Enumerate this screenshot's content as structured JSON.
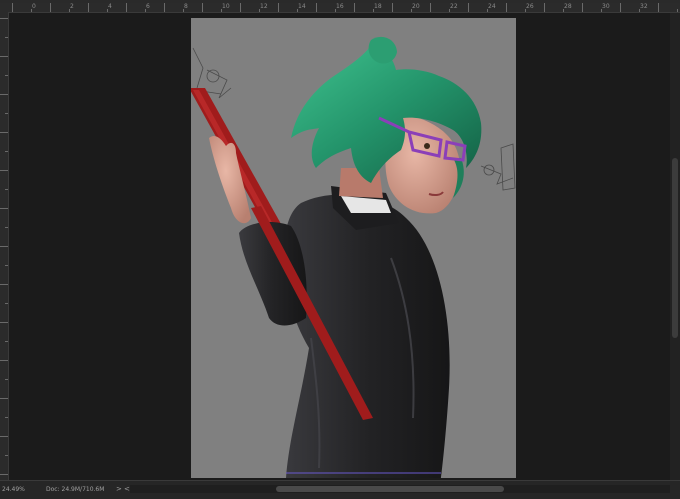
{
  "ruler": {
    "top_labels": [
      "0",
      "2",
      "4",
      "6",
      "8",
      "10",
      "12",
      "14",
      "16",
      "18",
      "20",
      "22",
      "24",
      "26",
      "28",
      "30",
      "32"
    ]
  },
  "status": {
    "zoom": "24.49%",
    "doc": "Doc: 24.9M/710.6M",
    "arrow_right": ">",
    "arrow_left": "<"
  },
  "icons": {
    "status_menu": "chevron-right-icon",
    "scroll_left": "chevron-left-icon"
  },
  "colors": {
    "workspace": "#1b1b1b",
    "canvas_bg": "#808080",
    "hair": "#2f9e74",
    "staff": "#9e1a1a",
    "glasses": "#8b3fb8",
    "uniform": "#262626"
  }
}
